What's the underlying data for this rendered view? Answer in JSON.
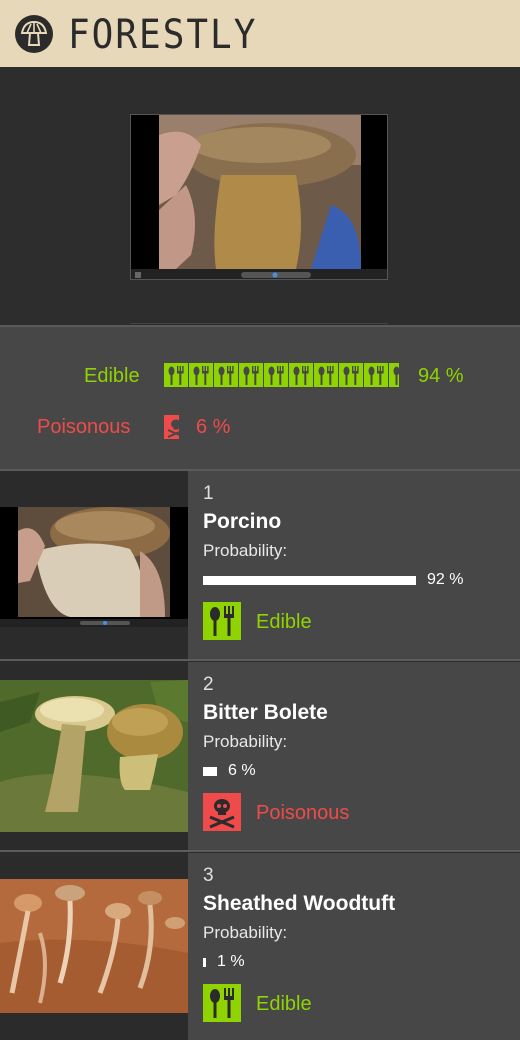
{
  "app": {
    "brand": "FORESTLY",
    "logo_icon": "mushroom-logo-icon"
  },
  "colors": {
    "header_bg": "#e6d8b8",
    "edible": "#8fd400",
    "poisonous": "#ef4b4b",
    "panel": "#474747"
  },
  "summary": {
    "edible": {
      "label": "Edible",
      "percent_text": "94 %",
      "value": 0.94,
      "icon": "spoon-fork-icon"
    },
    "poisonous": {
      "label": "Poisonous",
      "percent_text": "6 %",
      "value": 0.06,
      "icon": "skull-crossbones-icon"
    }
  },
  "results": [
    {
      "rank": "1",
      "name": "Porcino",
      "probability_label": "Probability:",
      "probability_text": "92 %",
      "probability": 0.92,
      "class_label": "Edible",
      "class": "edible",
      "icon": "spoon-fork-icon"
    },
    {
      "rank": "2",
      "name": "Bitter Bolete",
      "probability_label": "Probability:",
      "probability_text": "6 %",
      "probability": 0.06,
      "class_label": "Poisonous",
      "class": "poisonous",
      "icon": "skull-crossbones-icon"
    },
    {
      "rank": "3",
      "name": "Sheathed Woodtuft",
      "probability_label": "Probability:",
      "probability_text": "1 %",
      "probability": 0.01,
      "class_label": "Edible",
      "class": "edible",
      "icon": "spoon-fork-icon"
    }
  ]
}
